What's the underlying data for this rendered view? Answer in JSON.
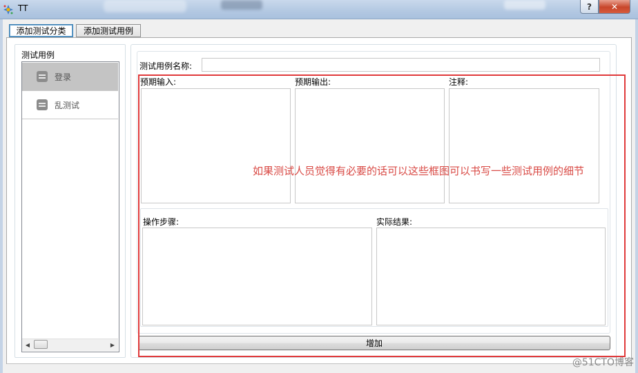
{
  "window": {
    "title": "TT",
    "help_label": "?",
    "close_label": "✕"
  },
  "tabs": [
    {
      "label": "添加测试分类",
      "active": true
    },
    {
      "label": "添加测试用例",
      "active": false
    }
  ],
  "left_panel": {
    "title": "测试用例",
    "items": [
      {
        "label": "登录",
        "selected": true,
        "icon": "list-icon"
      },
      {
        "label": "乱测试",
        "selected": false,
        "icon": "list-icon"
      }
    ],
    "scroll_left": "◀",
    "scroll_right": "▶"
  },
  "form": {
    "name_label": "测试用例名称:",
    "name_value": "",
    "expected_input_label": "预期输入:",
    "expected_output_label": "预期输出:",
    "note_label": "注释:",
    "steps_label": "操作步骤:",
    "actual_result_label": "实际结果:",
    "add_button": "增加"
  },
  "annotation": {
    "text": "如果测试人员觉得有必要的话可以这些框图可以书写一些测试用例的细节",
    "color": "#e0393a"
  },
  "watermark": "@51CTO博客"
}
